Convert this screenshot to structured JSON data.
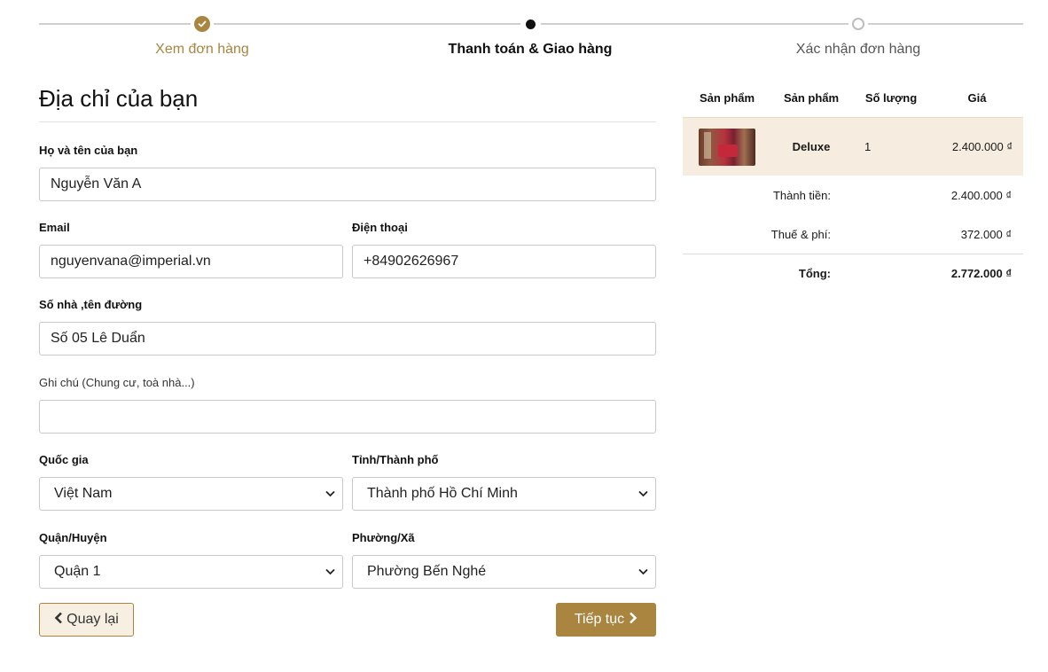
{
  "stepper": {
    "steps": [
      {
        "label": "Xem đơn hàng",
        "state": "done"
      },
      {
        "label": "Thanh toán & Giao hàng",
        "state": "current"
      },
      {
        "label": "Xác nhận đơn hàng",
        "state": "pending"
      }
    ]
  },
  "form": {
    "title": "Địa chỉ của bạn",
    "fullname": {
      "label": "Họ và tên của bạn",
      "value": "Nguyễn Văn A"
    },
    "email": {
      "label": "Email",
      "value": "nguyenvana@imperial.vn"
    },
    "phone": {
      "label": "Điện thoại",
      "value": "+84902626967"
    },
    "street": {
      "label": "Số nhà ,tên đường",
      "value": "Số 05 Lê Duẩn"
    },
    "note": {
      "label": "Ghi chú (Chung cư, toà nhà...)",
      "value": ""
    },
    "country": {
      "label": "Quốc gia",
      "selected": "Việt Nam"
    },
    "province": {
      "label": "Tỉnh/Thành phố",
      "selected": "Thành phố Hồ Chí Minh"
    },
    "district": {
      "label": "Quận/Huyện",
      "selected": "Quận 1"
    },
    "ward": {
      "label": "Phường/Xã",
      "selected": "Phường Bến Nghé"
    },
    "back_label": "Quay lại",
    "next_label": "Tiếp tục"
  },
  "summary": {
    "headers": [
      "Sản phẩm",
      "Sản phẩm",
      "Số lượng",
      "Giá"
    ],
    "item": {
      "name": "Deluxe",
      "qty": "1",
      "price": "2.400.000 ₫"
    },
    "subtotal": {
      "label": "Thành tiền:",
      "value": "2.400.000 ₫"
    },
    "tax": {
      "label": "Thuế & phí:",
      "value": "372.000 ₫"
    },
    "total": {
      "label": "Tổng:",
      "value": "2.772.000 ₫"
    }
  },
  "colors": {
    "accent": "#a98540",
    "highlight_row": "#f6ede0"
  }
}
